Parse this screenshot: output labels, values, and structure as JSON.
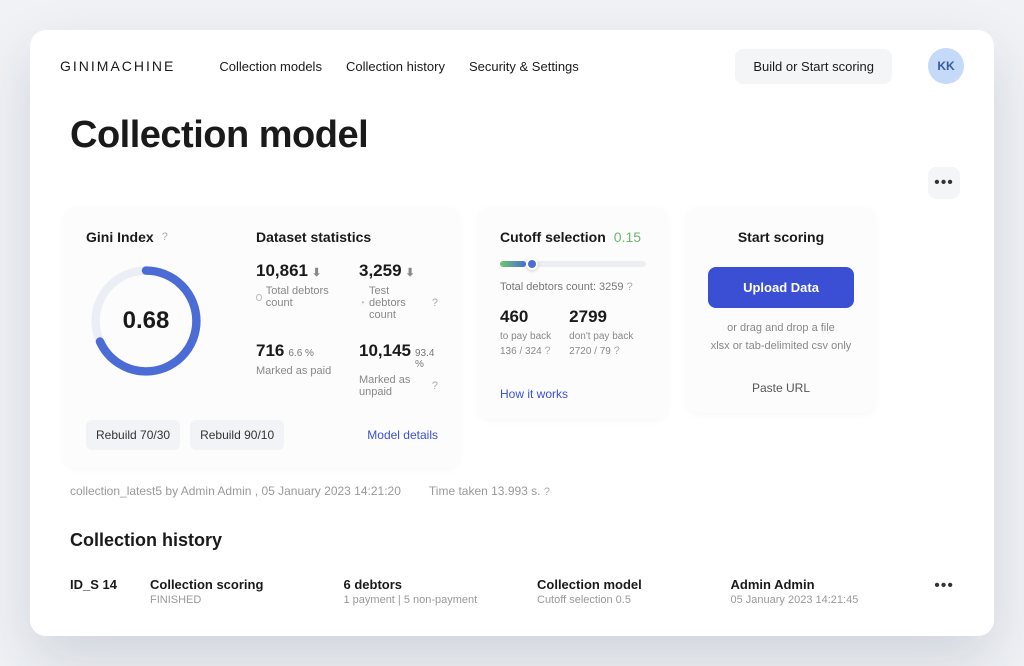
{
  "brand": "GINIMACHINE",
  "nav": {
    "collection_models": "Collection models",
    "collection_history": "Collection history",
    "security_settings": "Security & Settings"
  },
  "header": {
    "build_button": "Build or Start scoring",
    "avatar_initials": "KK"
  },
  "page_title": "Collection model",
  "gini": {
    "title": "Gini Index",
    "value": "0.68",
    "rebuild_7030": "Rebuild 70/30",
    "rebuild_9010": "Rebuild 90/10"
  },
  "dataset": {
    "title": "Dataset statistics",
    "stats": [
      {
        "value": "10,861",
        "label": "Total debtors count",
        "download": true,
        "icon": "circle"
      },
      {
        "value": "3,259",
        "label": "Test debtors count",
        "download": true,
        "icon": "clock",
        "help": true
      },
      {
        "value": "716",
        "pct": "6.6 %",
        "label": "Marked as paid"
      },
      {
        "value": "10,145",
        "pct": "93.4 %",
        "label": "Marked as unpaid",
        "help": true
      }
    ],
    "model_details": "Model details"
  },
  "cutoff": {
    "title": "Cutoff selection",
    "value": "0.15",
    "total_label": "Total debtors count: 3259",
    "payback": {
      "num": "460",
      "label": "to pay back",
      "detail": "136 / 324"
    },
    "dontpay": {
      "num": "2799",
      "label": "don't pay back",
      "detail": "2720 / 79"
    },
    "how_link": "How it works"
  },
  "scoring": {
    "title": "Start scoring",
    "upload_button": "Upload Data",
    "drag_hint": "or drag and drop a file",
    "format_hint": "xlsx or tab-delimited csv only",
    "paste_url": "Paste URL"
  },
  "meta": {
    "line1": "collection_latest5 by Admin Admin , 05 January 2023 14:21:20",
    "line2": "Time taken 13.993 s."
  },
  "history": {
    "title": "Collection history",
    "row": {
      "id": "ID_S 14",
      "scoring_title": "Collection scoring",
      "scoring_status": "FINISHED",
      "debtors_title": "6 debtors",
      "debtors_detail": "1 payment | 5 non-payment",
      "model_title": "Collection model",
      "model_detail": "Cutoff selection 0.5",
      "user": "Admin Admin",
      "timestamp": "05 January 2023 14:21:45"
    }
  }
}
